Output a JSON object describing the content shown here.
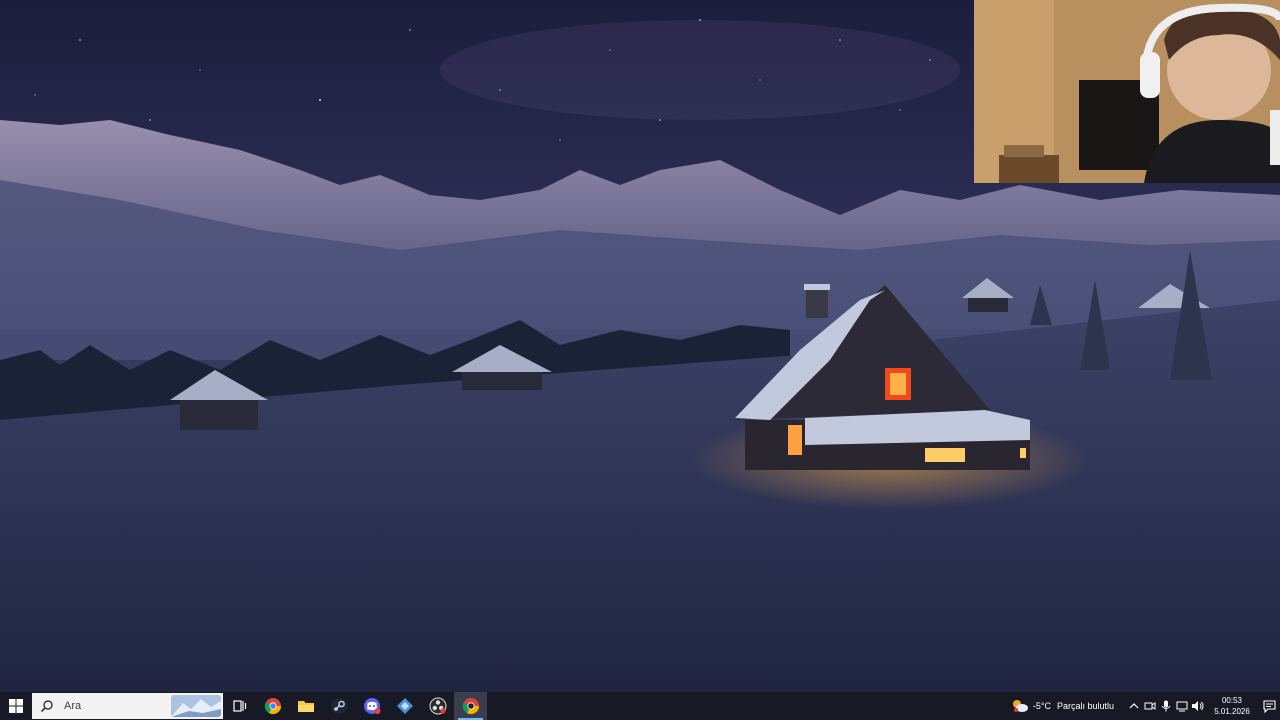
{
  "desktop": {
    "wallpaper": "snowy-night-mountain-cabin",
    "webcam_overlay": "webcam-feed-person-with-headphones"
  },
  "taskbar": {
    "search": {
      "placeholder": "Ara"
    },
    "apps": [
      "task-view-icon",
      "chrome-icon",
      "file-explorer-icon",
      "steam-icon",
      "discord-icon",
      "app-icon",
      "obs-icon",
      "chrome-canary-icon"
    ],
    "weather": {
      "temperature": "-5°C",
      "condition": "Parçalı bulutlu"
    },
    "clock": {
      "time": "00:53",
      "date": "5.01.2026"
    },
    "accent_color": "#79b4f5"
  }
}
